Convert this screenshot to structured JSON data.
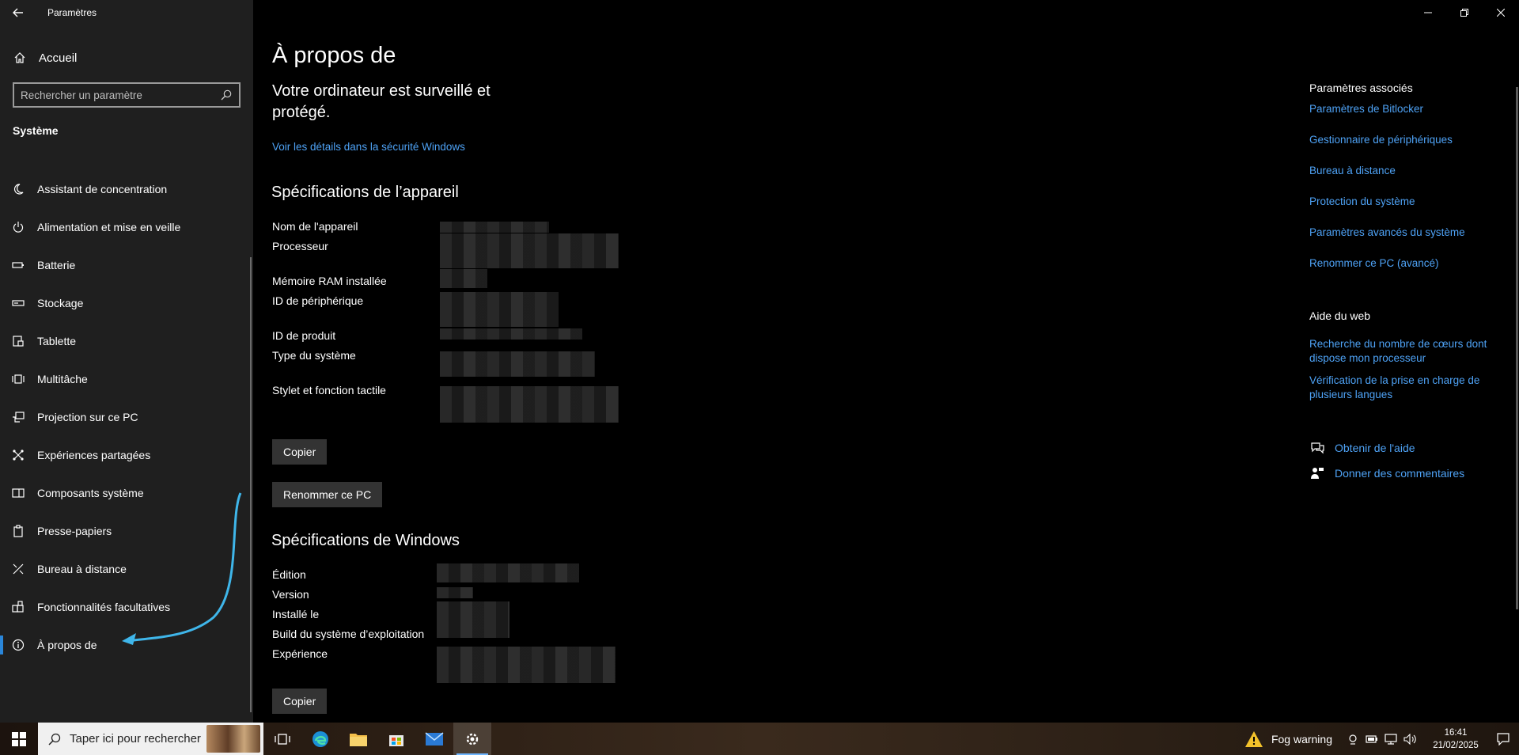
{
  "window": {
    "app_title": "Paramètres"
  },
  "sidebar": {
    "home_label": "Accueil",
    "search_placeholder": "Rechercher un paramètre",
    "section_title": "Système",
    "items": [
      {
        "label": "Assistant de concentration",
        "icon": "moon-icon"
      },
      {
        "label": "Alimentation et mise en veille",
        "icon": "power-icon"
      },
      {
        "label": "Batterie",
        "icon": "battery-icon"
      },
      {
        "label": "Stockage",
        "icon": "storage-icon"
      },
      {
        "label": "Tablette",
        "icon": "tablet-icon"
      },
      {
        "label": "Multitâche",
        "icon": "multitask-icon"
      },
      {
        "label": "Projection sur ce PC",
        "icon": "projection-icon"
      },
      {
        "label": "Expériences partagées",
        "icon": "shared-icon"
      },
      {
        "label": "Composants système",
        "icon": "components-icon"
      },
      {
        "label": "Presse-papiers",
        "icon": "clipboard-icon"
      },
      {
        "label": "Bureau à distance",
        "icon": "remote-icon"
      },
      {
        "label": "Fonctionnalités facultatives",
        "icon": "features-icon"
      },
      {
        "label": "À propos de",
        "icon": "info-icon",
        "active": true
      }
    ]
  },
  "main": {
    "page_title": "À propos de",
    "protection_title": "Votre ordinateur est surveillé et protégé.",
    "security_link": "Voir les détails dans la sécurité Windows",
    "device_specs": {
      "heading": "Spécifications de l’appareil",
      "labels": [
        "Nom de l'appareil",
        "Processeur",
        "Mémoire RAM installée",
        "ID de périphérique",
        "ID de produit",
        "Type du système",
        "Stylet et fonction tactile"
      ],
      "copy_button": "Copier",
      "rename_button": "Renommer ce PC"
    },
    "windows_specs": {
      "heading": "Spécifications de Windows",
      "labels": [
        "Édition",
        "Version",
        "Installé le",
        "Build du système d’exploitation",
        "Expérience"
      ],
      "copy_button": "Copier"
    }
  },
  "related": {
    "heading": "Paramètres associés",
    "links": [
      "Paramètres de Bitlocker",
      "Gestionnaire de périphériques",
      "Bureau à distance",
      "Protection du système",
      "Paramètres avancés du système",
      "Renommer ce PC (avancé)"
    ],
    "web_help_heading": "Aide du web",
    "web_links": [
      "Recherche du nombre de cœurs dont dispose mon processeur",
      "Vérification de la prise en charge de plusieurs langues"
    ],
    "get_help": "Obtenir de l'aide",
    "feedback": "Donner des commentaires"
  },
  "taskbar": {
    "search_placeholder": "Taper ici pour rechercher",
    "weather_label": "Fog warning",
    "time": "16:41",
    "date": "21/02/2025",
    "apps": [
      "task-view-icon",
      "edge-icon",
      "file-explorer-icon",
      "store-icon",
      "mail-icon",
      "settings-icon"
    ]
  },
  "colors": {
    "accent": "#4ea2f5",
    "sidebar_bg": "#1f1f1f",
    "annotation_arrow": "#3fb6ea"
  }
}
